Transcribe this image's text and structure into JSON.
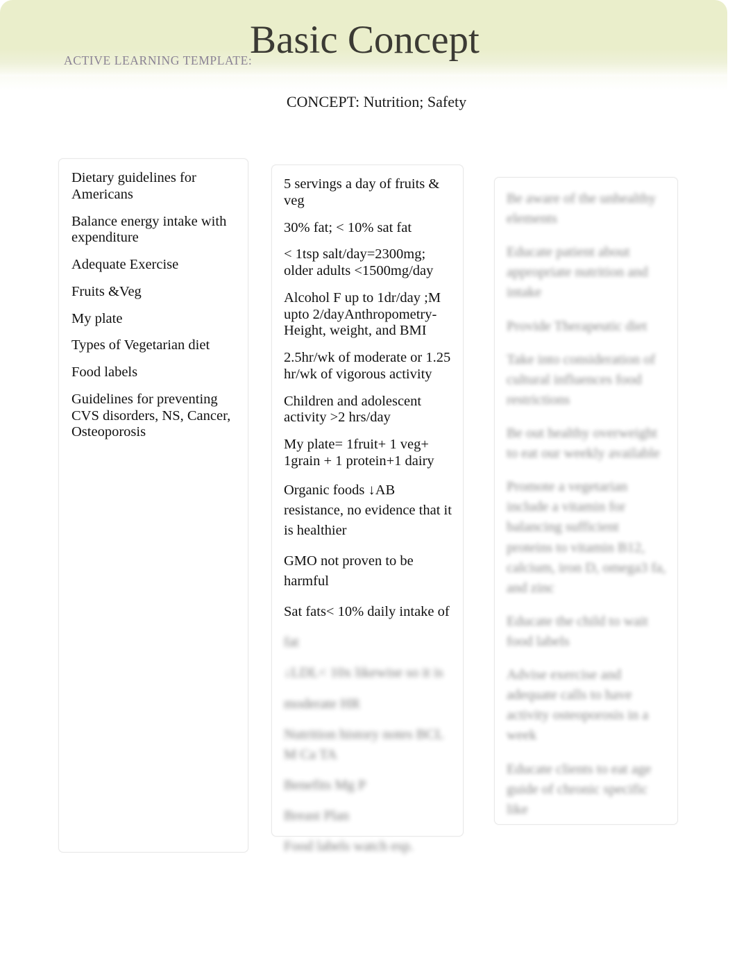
{
  "header": {
    "kicker": "ACTIVE LEARNING TEMPLATE:",
    "title": "Basic Concept",
    "concept_line": "CONCEPT: Nutrition; Safety",
    "banner_color": "#eaeecb",
    "kicker_color": "#8a8294",
    "title_color": "#3b3a34"
  },
  "left_box": {
    "name": "related-content-box",
    "lines": [
      "Dietary guidelines for Americans",
      "Balance energy intake with expenditure",
      "Adequate Exercise",
      "Fruits &Veg",
      "My plate",
      "Types of Vegetarian diet",
      "Food labels",
      "Guidelines for preventing CVS disorders, NS, Cancer, Osteoporosis"
    ]
  },
  "middle_box": {
    "name": "underlying-principles-box",
    "lines": [
      "5 servings a day of fruits & veg",
      "30% fat; < 10% sat fat",
      "< 1tsp salt/day=2300mg; older adults <1500mg/day",
      "Alcohol F up to 1dr/day ;M upto 2/dayAnthropometry-Height, weight, and BMI",
      " 2.5hr/wk of moderate or 1.25 hr/wk of vigorous activity",
      "Children and adolescent activity >2 hrs/day",
      "My plate= 1fruit+ 1 veg+ 1grain + 1 protein+1 dairy",
      "Organic foods ↓AB resistance, no evidence that it is healthier",
      "GMO not proven to be harmful",
      "Sat fats< 10% daily intake of"
    ],
    "obscured_lines": [
      "fat",
      "↓LDL< 10x likewise so it is",
      "moderate HR",
      "Nutrition history notes BCL M Ca TA",
      "Benefits Mg P",
      "Breast Plan",
      "Food labels watch esp."
    ]
  },
  "right_box": {
    "name": "nursing-interventions-box",
    "obscured_lines": [
      "Be aware of the unhealthy elements",
      "Educate patient about appropriate nutrition and intake",
      "Provide Therapeutic diet",
      "Take into consideration of cultural influences food restrictions",
      "Be out healthy overweight to eat our weekly available",
      "Promote a vegetarian include a vitamin for balancing sufficient proteins to vitamin B12, calcium, iron D, omega3 fa, and zinc",
      "Educate the child to wait food labels",
      "Advise exercise and adequate calls to have activity osteoporosis in a week",
      "Educate clients to eat age guide of chronic specific like"
    ]
  }
}
